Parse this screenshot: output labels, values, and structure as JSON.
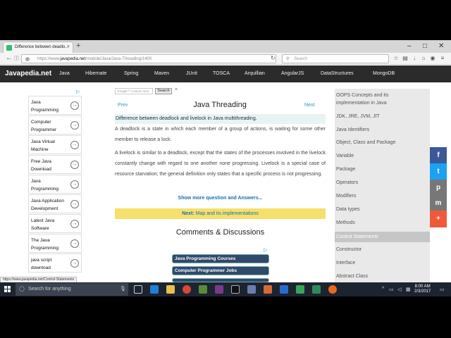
{
  "browser": {
    "tab_title": "Difference between deadlo...",
    "tab_close": "×",
    "new_tab": "+",
    "url_prefix": "https://www.",
    "url_host": "javapedia.net",
    "url_path": "/module/Java/Java-Threading/1400",
    "search_placeholder": "Search",
    "status_url": "https://www.javapedia.net/Control-Statements"
  },
  "site": {
    "logo": "Javapedia.net",
    "menu": [
      "Java",
      "Hibernate",
      "Spring",
      "Maven",
      "JUnit",
      "TOSCA",
      "Arquillian",
      "AngularJS",
      "DataStructures",
      "MongoDB"
    ]
  },
  "left_ads": {
    "items": [
      {
        "label": "Java Programming"
      },
      {
        "label": "Computer Programmer"
      },
      {
        "label": "Java Virtual Machine"
      },
      {
        "label": "Free Java Download"
      },
      {
        "label": "Java Programming"
      },
      {
        "label": "Java Application Development"
      },
      {
        "label": "Latest Java Software"
      },
      {
        "label": "The Java Programming"
      },
      {
        "label": "java script download"
      }
    ]
  },
  "content": {
    "gsearch_placeholder": "Google™ Custom Sea",
    "gsearch_button": "Search",
    "gsearch_clear": "×",
    "prev": "Prev",
    "title": "Java Threading",
    "next": "Next",
    "question": "Difference between deadlock and livelock in Java multithreading.",
    "para1": "A deadlock is a state in which each member of a group of actions, is waiting for some other member to release a lock.",
    "para2": "A livelock is similar to a deadlock, except that the states of the processes involved in the livelock constantly change with regard to one another none progressing. Livelock is a special case of resource starvation; the general definition only states that a specific process is not progressing.",
    "show_more": "Show more question and Answers...",
    "next_bar_label": "Next:",
    "next_bar_text": "Map and its implementations",
    "comments": "Comments & Discussions",
    "bottom_ads": [
      "Java Programming Courses",
      "Computer Programmer Jobs"
    ]
  },
  "sidebar": {
    "items": [
      "OOPS Concepts and its implementation in Java",
      "JDK, JRE, JVM, JIT",
      "Java Identifiers",
      "Object, Class and Package",
      "Variable",
      "Package",
      "Operators",
      "Modifiers",
      "Data types",
      "Methods",
      "Control Statements",
      "Constructor",
      "Interface",
      "Abstract Class"
    ],
    "active": "Control Statements"
  },
  "social": [
    "f",
    "t",
    "p",
    "m",
    "+"
  ],
  "taskbar": {
    "search_placeholder": "Search for anything",
    "time": "8:00 AM",
    "date": "2/3/2017"
  }
}
